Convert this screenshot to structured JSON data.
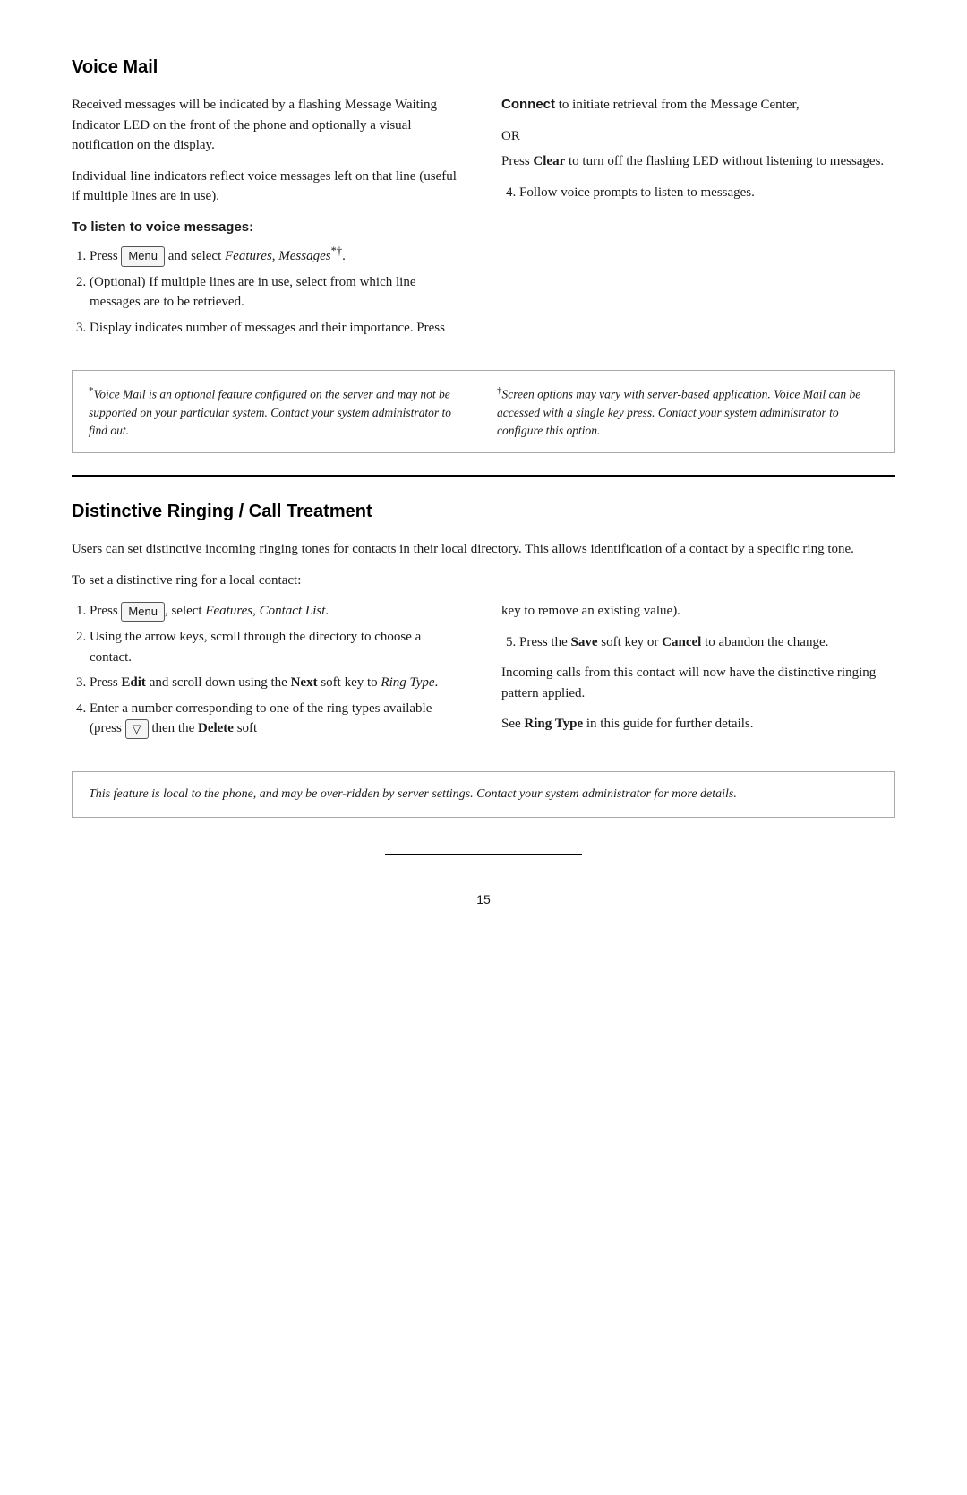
{
  "voice_mail": {
    "title": "Voice Mail",
    "col_left_p1": "Received messages will be indicated by a flashing Message Waiting Indicator LED on the front of the phone and optionally a visual notification on the display.",
    "col_left_p2": "Individual line indicators reflect voice messages left on that line (useful if multiple lines are in use).",
    "listen_label": "To listen to voice messages:",
    "steps_left": [
      {
        "num": "1",
        "html_key": "menu",
        "text_before": "Press",
        "text_after": "and select ",
        "italic": "Features, Messages",
        "sup": "*†",
        "trailing": "."
      },
      {
        "num": "2",
        "text": "(Optional) If multiple lines are in use, select from which line messages are to be retrieved."
      },
      {
        "num": "3",
        "text": "Display indicates number of messages and their importance. Press"
      }
    ],
    "connect_bold": "Connect",
    "connect_text": " to initiate retrieval from the Message Center,",
    "or_text": "OR",
    "clear_bold": "Clear",
    "clear_text": " to turn off the flashing LED without listening to messages.",
    "step4_text": "Follow voice prompts to listen to messages.",
    "footnote_left_sup": "*",
    "footnote_left": "Voice Mail is an optional feature configured on the server and may not be supported on your particular system. Contact your system administrator to find out.",
    "footnote_right_sup": "†",
    "footnote_right": "Screen options may vary with server-based application. Voice Mail can be accessed with a single key press. Contact your system administrator to configure this option."
  },
  "distinctive_ringing": {
    "title": "Distinctive Ringing / Call Treatment",
    "intro_p1": "Users can set distinctive incoming ringing tones for contacts in their local directory. This allows identification of a contact by a specific ring tone.",
    "intro_p2": "To set a distinctive ring for a local contact:",
    "steps_left": [
      {
        "num": "1",
        "text_before": "Press",
        "key": "menu",
        "text_after": ", select ",
        "italic": "Features, Contact List",
        "trailing": "."
      },
      {
        "num": "2",
        "text": "Using the arrow keys, scroll through the directory to choose a contact."
      },
      {
        "num": "3",
        "text_before": "Press ",
        "bold": "Edit",
        "text_after": " and scroll down using the ",
        "bold2": "Next",
        "text_end": " soft key to ",
        "italic": "Ring Type",
        "trailing": "."
      },
      {
        "num": "4",
        "text_before": "Enter a number corresponding to one of the ring types available (press ",
        "key": "arrow_down",
        "text_after": " then the ",
        "bold": "Delete",
        "text_end": " soft"
      }
    ],
    "step5_text_before": "Press the ",
    "step5_bold": "Save",
    "step5_text_mid": " soft key or ",
    "step5_bold2": "Cancel",
    "step5_text_end": " to abandon the change.",
    "right_key_text": "key to remove an existing value).",
    "incoming_text": "Incoming calls from this contact will now have the distinctive ringing pattern applied.",
    "ring_type_before": "See ",
    "ring_type_bold": "Ring Type",
    "ring_type_after": " in this guide for further details.",
    "italic_box": "This feature is local to the phone, and may be over-ridden by server settings. Contact your system administrator for more details.",
    "page_number": "15"
  },
  "buttons": {
    "menu_label": "Menu",
    "arrow_down_label": "▽"
  }
}
